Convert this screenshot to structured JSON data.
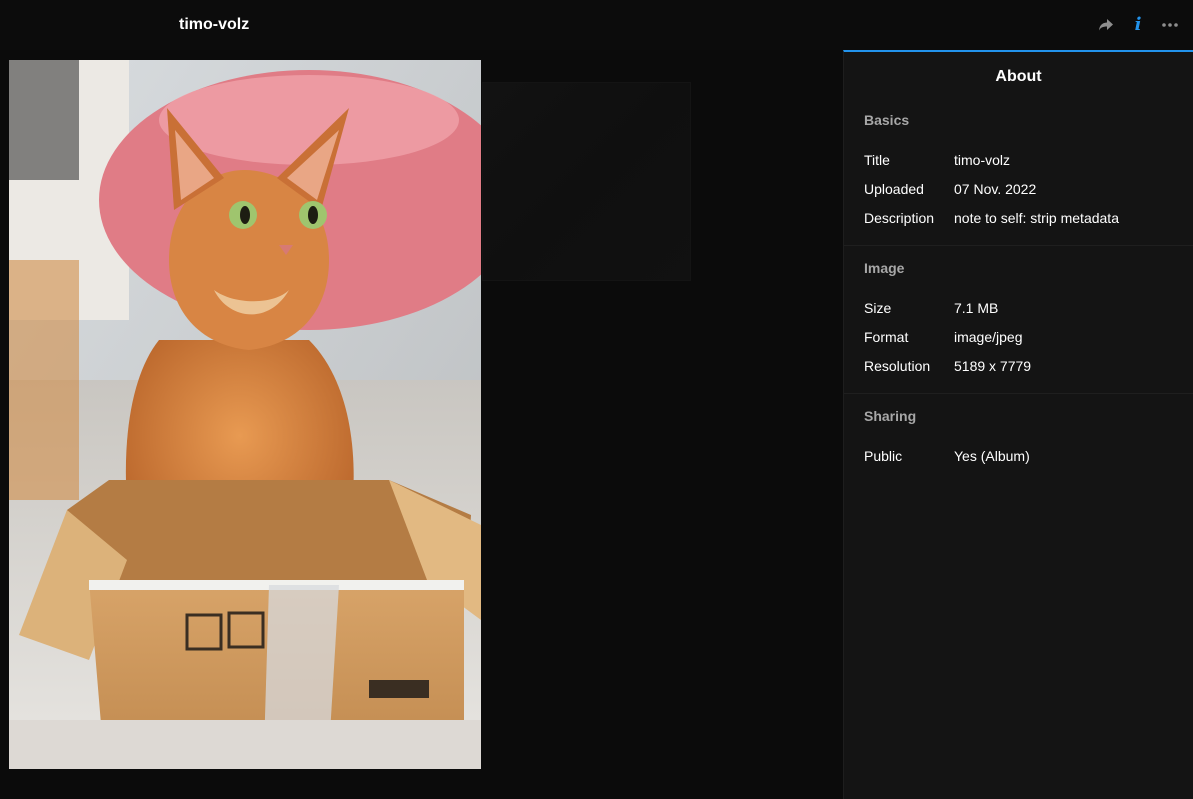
{
  "header": {
    "title": "timo-volz",
    "icons": [
      "share-icon",
      "info-icon",
      "more-icon"
    ],
    "accent": "#2293ec"
  },
  "sidebar": {
    "heading": "About",
    "sections": {
      "basics": {
        "label": "Basics",
        "rows": [
          {
            "key": "Title",
            "value": "timo-volz"
          },
          {
            "key": "Uploaded",
            "value": "07 Nov. 2022"
          },
          {
            "key": "Description",
            "value": "note to self: strip metadata"
          }
        ]
      },
      "image": {
        "label": "Image",
        "rows": [
          {
            "key": "Size",
            "value": "7.1 MB"
          },
          {
            "key": "Format",
            "value": "image/jpeg"
          },
          {
            "key": "Resolution",
            "value": "5189 x 7779"
          }
        ]
      },
      "sharing": {
        "label": "Sharing",
        "rows": [
          {
            "key": "Public",
            "value": "Yes (Album)"
          }
        ]
      }
    }
  }
}
